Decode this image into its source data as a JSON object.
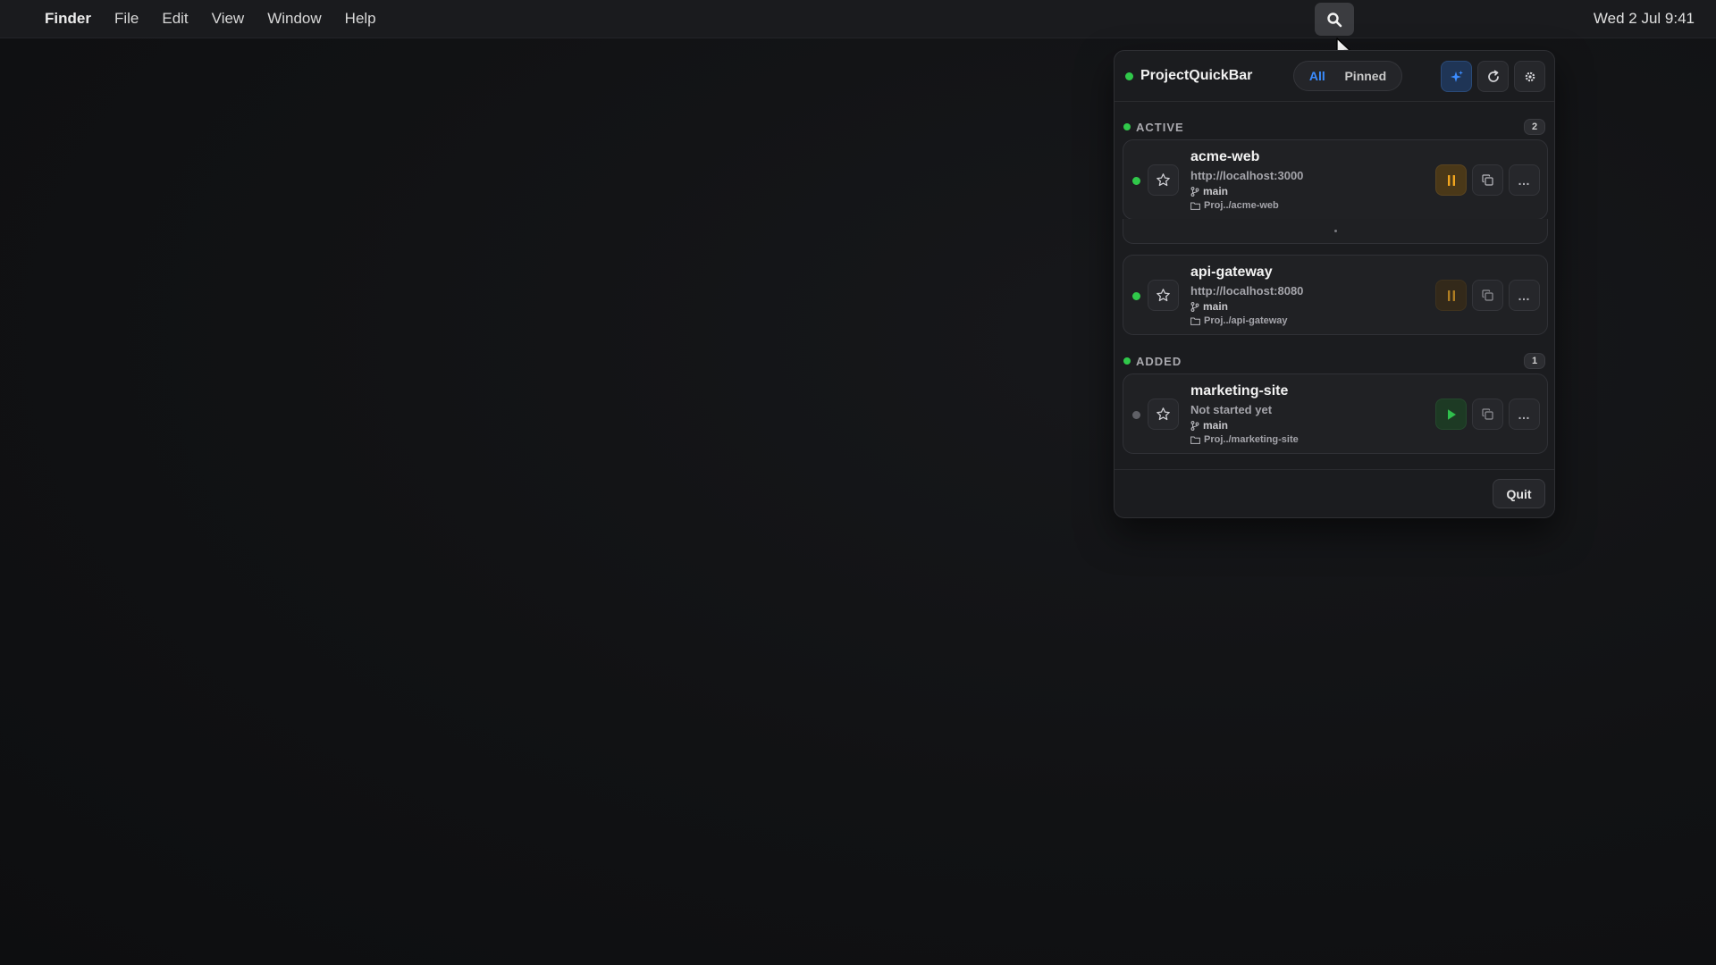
{
  "menubar": {
    "app_name": "Finder",
    "menus": [
      "File",
      "Edit",
      "View",
      "Window",
      "Help"
    ],
    "clock": "Wed 2 Jul 9:41"
  },
  "panel": {
    "title": "ProjectQuickBar",
    "filters": {
      "all": "All",
      "pinned": "Pinned",
      "selected": "All"
    },
    "accent_color": "#3b8cff",
    "status_color": "#30c84a"
  },
  "sections": {
    "active": {
      "label": "ACTIVE",
      "count": "2",
      "projects": [
        {
          "name": "acme-web",
          "url": "http://localhost:3000",
          "branch": "main",
          "path": "Proj../acme-web",
          "status": "running"
        },
        {
          "name": "api-gateway",
          "url": "http://localhost:8080",
          "branch": "main",
          "path": "Proj../api-gateway",
          "status": "running"
        }
      ]
    },
    "added": {
      "label": "ADDED",
      "count": "1",
      "projects": [
        {
          "name": "marketing-site",
          "url": "Not started yet",
          "branch": "main",
          "path": "Proj../marketing-site",
          "status": "stopped"
        }
      ]
    }
  },
  "footer": {
    "quit_label": "Quit"
  },
  "icons": {
    "search": "search-icon",
    "sparkle": "sparkle-icon",
    "refresh": "refresh-icon",
    "settings": "gear-icon",
    "star": "star-icon",
    "pause": "pause-icon",
    "play": "play-icon",
    "copy": "copy-icon",
    "branch": "git-branch-icon",
    "folder": "folder-icon"
  }
}
